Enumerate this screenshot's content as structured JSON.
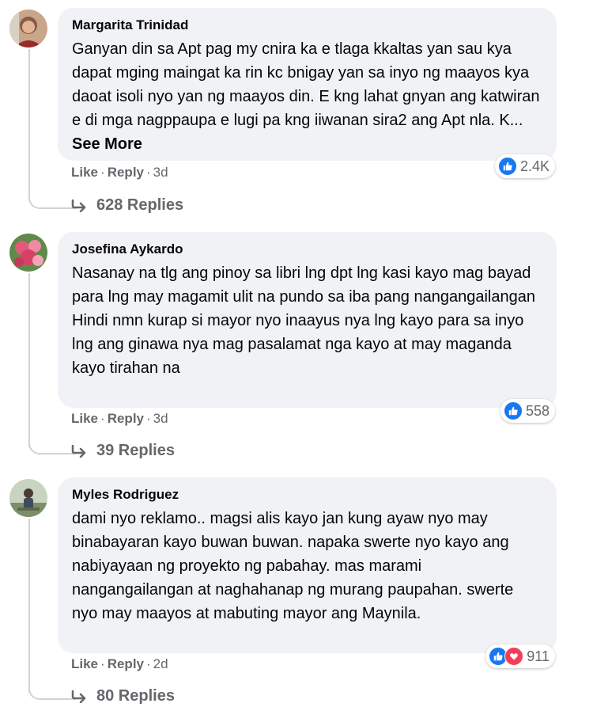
{
  "comments": [
    {
      "author": "Margarita Trinidad",
      "text": "Ganyan din sa Apt pag my cnira ka e tlaga kkaltas yan sau kya dapat mging maingat ka rin kc bnigay yan sa inyo ng maayos kya daoat isoli nyo yan ng maayos din. E kng lahat gnyan ang katwiran e di mga nagppaupa e lugi pa kng iiwanan sira2 ang Apt nla. K...",
      "see_more": "See More",
      "like": "Like",
      "reply": "Reply",
      "time": "3d",
      "reaction_count": "2.4K",
      "reaction_icons": [
        "like-icon"
      ],
      "replies": "628 Replies"
    },
    {
      "author": "Josefina Aykardo",
      "text": "Nasanay na tlg ang pinoy sa libri lng dpt lng kasi kayo mag bayad para lng may magamit ulit na pundo sa iba pang nangangailangan Hindi nmn kurap si mayor nyo inaayus nya lng kayo para sa inyo lng ang ginawa nya mag pasalamat nga kayo at may maganda kayo tirahan na",
      "see_more": "",
      "like": "Like",
      "reply": "Reply",
      "time": "3d",
      "reaction_count": "558",
      "reaction_icons": [
        "like-icon"
      ],
      "replies": "39 Replies"
    },
    {
      "author": "Myles Rodriguez",
      "text": "dami nyo reklamo.. magsi alis kayo jan kung ayaw nyo may binabayaran kayo buwan buwan. napaka swerte nyo kayo ang nabiyayaan ng proyekto ng pabahay. mas marami nangangailangan at naghahanap ng murang paupahan. swerte nyo may maayos at mabuting mayor ang Maynila.",
      "see_more": "",
      "like": "Like",
      "reply": "Reply",
      "time": "2d",
      "reaction_count": "911",
      "reaction_icons": [
        "like-icon",
        "love-icon"
      ],
      "replies": "80 Replies"
    }
  ]
}
